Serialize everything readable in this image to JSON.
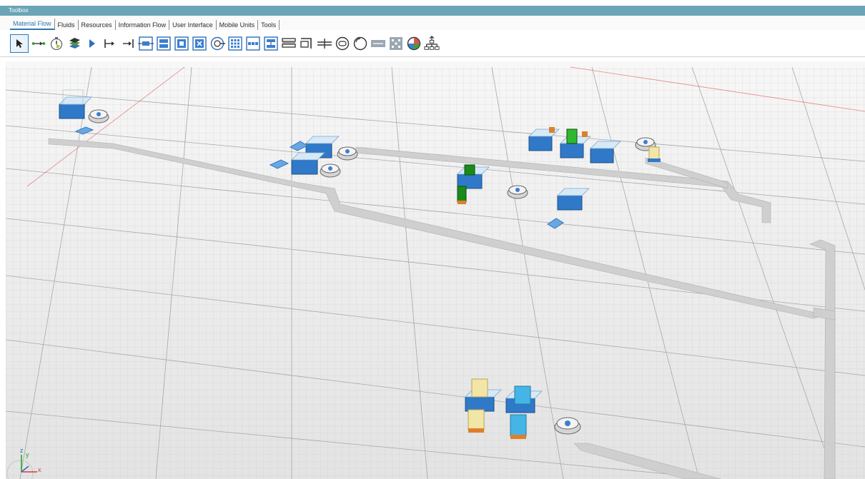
{
  "window": {
    "title": "Toolbox"
  },
  "tabs": [
    {
      "label": "Material Flow",
      "active": true
    },
    {
      "label": "Fluids"
    },
    {
      "label": "Resources"
    },
    {
      "label": "Information Flow"
    },
    {
      "label": "User Interface"
    },
    {
      "label": "Mobile Units"
    },
    {
      "label": "Tools"
    }
  ],
  "toolbar_icons": [
    "pointer-icon",
    "connector-icon",
    "event-controller-icon",
    "frame-icon",
    "source-icon",
    "entrance-icon",
    "exit-icon",
    "single-proc-icon",
    "parallel-proc-icon",
    "assembly-icon",
    "disassembly-icon",
    "shift-calendar-icon",
    "buffer-icon",
    "placebuffer-icon",
    "sorter-icon",
    "line-icon",
    "angular-converter-icon",
    "track-icon",
    "turntable-icon",
    "drain-icon",
    "flow-control-icon",
    "store-icon",
    "cycle-icon",
    "worker-pool-icon",
    "layout-icon"
  ],
  "viewport": {
    "axis_labels": {
      "z": "z",
      "y": "y",
      "x": "x"
    },
    "colors": {
      "floor": "#e4e4e4",
      "grid": "#b8b8b8",
      "conveyor": "#cfcfcf",
      "station_blue": "#2f79c8",
      "part_green": "#1a8a1a",
      "part_yellow": "#f2e6a6",
      "part_cyan": "#45b5e6"
    }
  }
}
